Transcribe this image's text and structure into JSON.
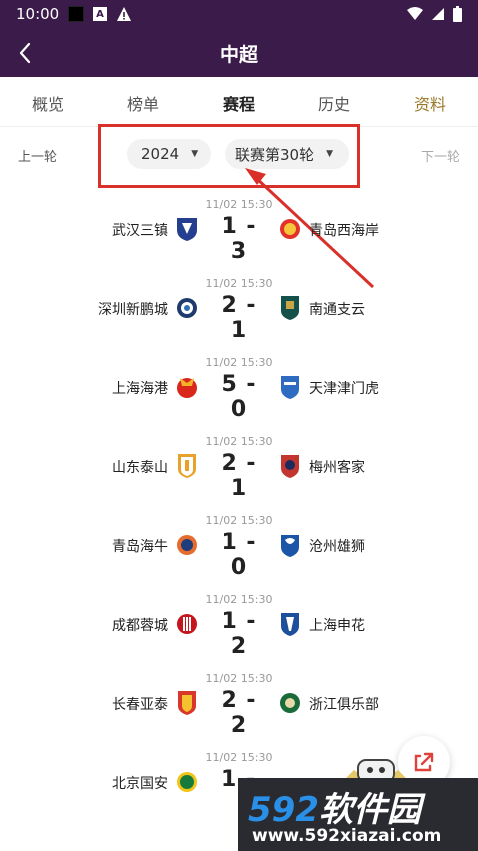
{
  "status_bar": {
    "time": "10:00",
    "a_badge": "A"
  },
  "header": {
    "title": "中超"
  },
  "tabs": [
    {
      "label": "概览"
    },
    {
      "label": "榜单"
    },
    {
      "label": "赛程"
    },
    {
      "label": "历史"
    },
    {
      "label": "资料"
    }
  ],
  "round_nav": {
    "prev": "上一轮",
    "next": "下一轮",
    "season": "2024",
    "round": "联赛第30轮"
  },
  "matches": [
    {
      "time": "11/02  15:30",
      "home": "武汉三镇",
      "score": "1 - 3",
      "away": "青岛西海岸"
    },
    {
      "time": "11/02  15:30",
      "home": "深圳新鹏城",
      "score": "2 - 1",
      "away": "南通支云"
    },
    {
      "time": "11/02  15:30",
      "home": "上海海港",
      "score": "5 - 0",
      "away": "天津津门虎"
    },
    {
      "time": "11/02  15:30",
      "home": "山东泰山",
      "score": "2 - 1",
      "away": "梅州客家"
    },
    {
      "time": "11/02  15:30",
      "home": "青岛海牛",
      "score": "1 - 0",
      "away": "沧州雄狮"
    },
    {
      "time": "11/02  15:30",
      "home": "成都蓉城",
      "score": "1 - 2",
      "away": "上海申花"
    },
    {
      "time": "11/02  15:30",
      "home": "长春亚泰",
      "score": "2 - 2",
      "away": "浙江俱乐部"
    },
    {
      "time": "11/02  15:30",
      "home": "北京国安",
      "score": "1 -",
      "away": ""
    }
  ],
  "watermark": {
    "num": "592",
    "text": "软件园",
    "url": "www.592xiazai.com"
  },
  "colors": {
    "header_bg": "#3b1b4a",
    "highlight": "#d9302a",
    "fab_icon": "#e0413a",
    "watermark_blue": "#2a8fe6"
  }
}
